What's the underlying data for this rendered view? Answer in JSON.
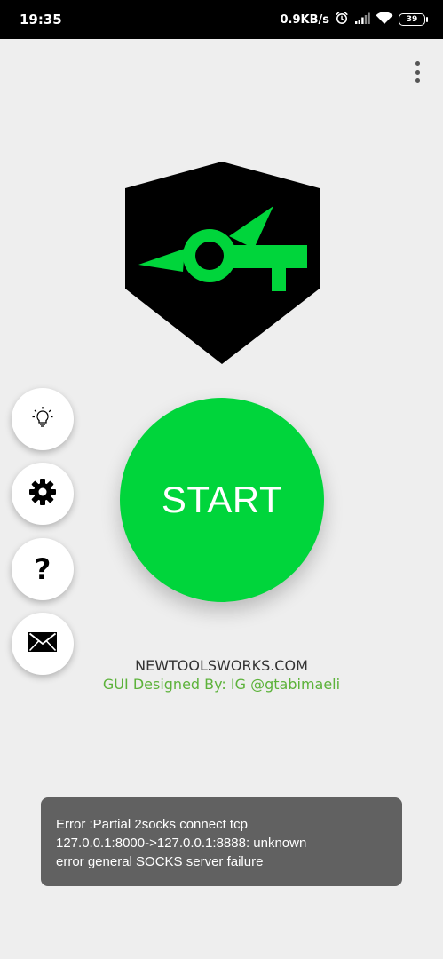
{
  "status_bar": {
    "time": "19:35",
    "net_speed": "0.9KB/s",
    "battery": "39",
    "icons": [
      "alarm-icon",
      "signal-icon",
      "wifi-icon",
      "battery-icon"
    ]
  },
  "menu": {
    "icon": "more-vert-icon"
  },
  "side_actions": {
    "items": [
      {
        "icon": "lightbulb-icon"
      },
      {
        "icon": "gear-icon"
      },
      {
        "icon": "help-icon",
        "glyph": "?"
      },
      {
        "icon": "mail-icon"
      }
    ]
  },
  "main": {
    "start_label": "START",
    "site": "NEWTOOLSWORKS.COM",
    "credit": "GUI  Designed By: IG @gtabimaeli"
  },
  "toast": {
    "lines": [
      "Error :Partial 2socks connect tcp",
      "127.0.0.1:8000->127.0.0.1:8888: unknown",
      "error general SOCKS server failure"
    ]
  },
  "colors": {
    "accent": "#00d53b",
    "credit_green": "#5cb23a",
    "background": "#eeeeee",
    "toast_bg": "#616161",
    "logo_bg": "#000000"
  }
}
